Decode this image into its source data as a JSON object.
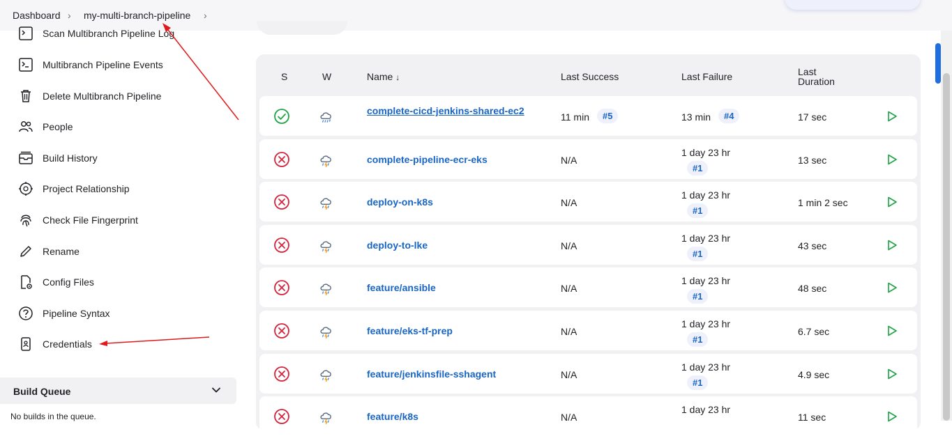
{
  "breadcrumb": {
    "items": [
      "Dashboard",
      "my-multi-branch-pipeline"
    ]
  },
  "sidebar": {
    "items": [
      {
        "label": "Scan Multibranch Pipeline Log",
        "icon": "terminal-log-icon"
      },
      {
        "label": "Multibranch Pipeline Events",
        "icon": "terminal-icon"
      },
      {
        "label": "Delete Multibranch Pipeline",
        "icon": "trash-icon"
      },
      {
        "label": "People",
        "icon": "people-icon"
      },
      {
        "label": "Build History",
        "icon": "build-history-icon"
      },
      {
        "label": "Project Relationship",
        "icon": "relationship-icon"
      },
      {
        "label": "Check File Fingerprint",
        "icon": "fingerprint-icon"
      },
      {
        "label": "Rename",
        "icon": "pencil-icon"
      },
      {
        "label": "Config Files",
        "icon": "config-file-icon"
      },
      {
        "label": "Pipeline Syntax",
        "icon": "help-icon"
      },
      {
        "label": "Credentials",
        "icon": "credentials-icon"
      }
    ]
  },
  "build_queue": {
    "title": "Build Queue",
    "empty_text": "No builds in the queue."
  },
  "table": {
    "headers": {
      "status": "S",
      "weather": "W",
      "name": "Name",
      "sort_indicator": "↓",
      "last_success": "Last Success",
      "last_failure": "Last Failure",
      "last_duration_1": "Last",
      "last_duration_2": "Duration"
    },
    "rows": [
      {
        "status": "success",
        "weather": "rain",
        "name": "complete-cicd-jenkins-shared-ec2",
        "last_success": "11 min",
        "last_success_build": "#5",
        "last_failure": "13 min",
        "last_failure_build": "#4",
        "duration": "17 sec"
      },
      {
        "status": "failure",
        "weather": "storm",
        "name": "complete-pipeline-ecr-eks",
        "last_success": "N/A",
        "last_success_build": "",
        "last_failure": "1 day 23 hr",
        "last_failure_build": "#1",
        "duration": "13 sec"
      },
      {
        "status": "failure",
        "weather": "storm",
        "name": "deploy-on-k8s",
        "last_success": "N/A",
        "last_success_build": "",
        "last_failure": "1 day 23 hr",
        "last_failure_build": "#1",
        "duration": "1 min 2 sec"
      },
      {
        "status": "failure",
        "weather": "storm",
        "name": "deploy-to-lke",
        "last_success": "N/A",
        "last_success_build": "",
        "last_failure": "1 day 23 hr",
        "last_failure_build": "#1",
        "duration": "43 sec"
      },
      {
        "status": "failure",
        "weather": "storm",
        "name": "feature/ansible",
        "last_success": "N/A",
        "last_success_build": "",
        "last_failure": "1 day 23 hr",
        "last_failure_build": "#1",
        "duration": "48 sec"
      },
      {
        "status": "failure",
        "weather": "storm",
        "name": "feature/eks-tf-prep",
        "last_success": "N/A",
        "last_success_build": "",
        "last_failure": "1 day 23 hr",
        "last_failure_build": "#1",
        "duration": "6.7 sec"
      },
      {
        "status": "failure",
        "weather": "storm",
        "name": "feature/jenkinsfile-sshagent",
        "last_success": "N/A",
        "last_success_build": "",
        "last_failure": "1 day 23 hr",
        "last_failure_build": "#1",
        "duration": "4.9 sec"
      },
      {
        "status": "failure",
        "weather": "storm",
        "name": "feature/k8s",
        "last_success": "N/A",
        "last_success_build": "",
        "last_failure": "1 day 23 hr",
        "last_failure_build": "",
        "duration": "11 sec"
      }
    ]
  },
  "colors": {
    "success": "#1ea446",
    "failure": "#d6223a",
    "link": "#1865c4",
    "annotation": "#e0191c"
  }
}
